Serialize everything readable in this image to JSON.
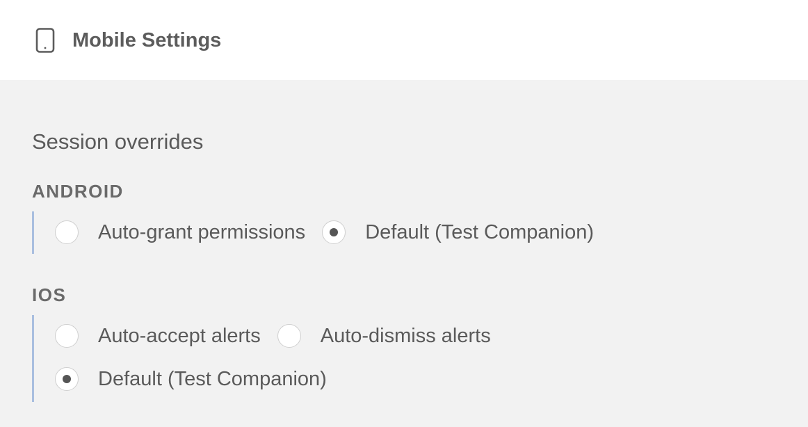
{
  "header": {
    "icon": "mobile-phone-icon",
    "title": "Mobile Settings"
  },
  "section": {
    "title": "Session overrides"
  },
  "android": {
    "label": "ANDROID",
    "options": [
      {
        "label": "Auto-grant permissions",
        "selected": false
      },
      {
        "label": "Default (Test Companion)",
        "selected": true
      }
    ]
  },
  "ios": {
    "label": "IOS",
    "options": [
      {
        "label": "Auto-accept alerts",
        "selected": false
      },
      {
        "label": "Auto-dismiss alerts",
        "selected": false
      },
      {
        "label": "Default (Test Companion)",
        "selected": true
      }
    ]
  },
  "colors": {
    "group_border": "#a9bfdf",
    "panel_background": "#f2f2f2"
  }
}
